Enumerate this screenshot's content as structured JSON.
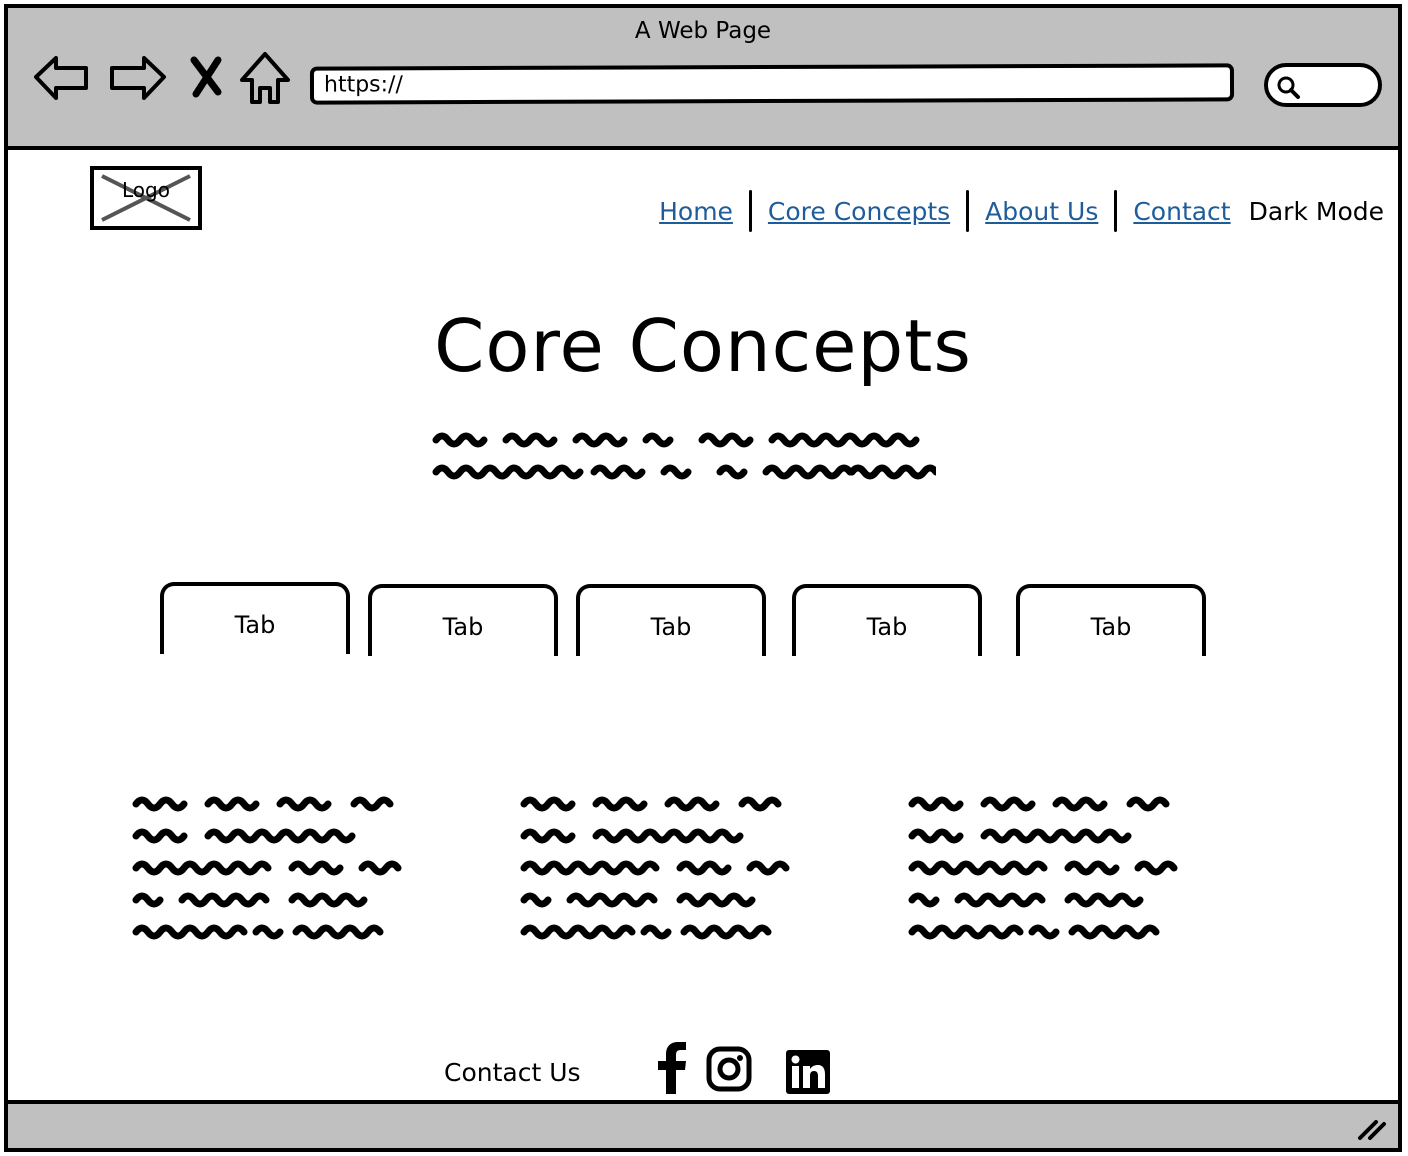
{
  "window": {
    "title": "A Web Page"
  },
  "browser": {
    "back_icon": "back-arrow-icon",
    "forward_icon": "forward-arrow-icon",
    "stop_icon": "close-icon",
    "home_icon": "home-icon",
    "url": "https://",
    "search_icon": "search-icon"
  },
  "header": {
    "logo_label": "Logo",
    "nav": [
      {
        "label": "Home"
      },
      {
        "label": "Core Concepts"
      },
      {
        "label": "About Us"
      },
      {
        "label": "Contact"
      }
    ],
    "dark_mode_label": "Dark Mode"
  },
  "main": {
    "title": "Core Concepts",
    "tabs": [
      {
        "label": "Tab"
      },
      {
        "label": "Tab"
      },
      {
        "label": "Tab"
      },
      {
        "label": "Tab"
      },
      {
        "label": "Tab"
      }
    ]
  },
  "footer": {
    "contact_label": "Contact Us",
    "social_icons": [
      "facebook-icon",
      "instagram-icon",
      "linkedin-icon"
    ]
  },
  "colors": {
    "chrome": "#c0c0c0",
    "link": "#1f5d9a",
    "ink": "#000000"
  }
}
